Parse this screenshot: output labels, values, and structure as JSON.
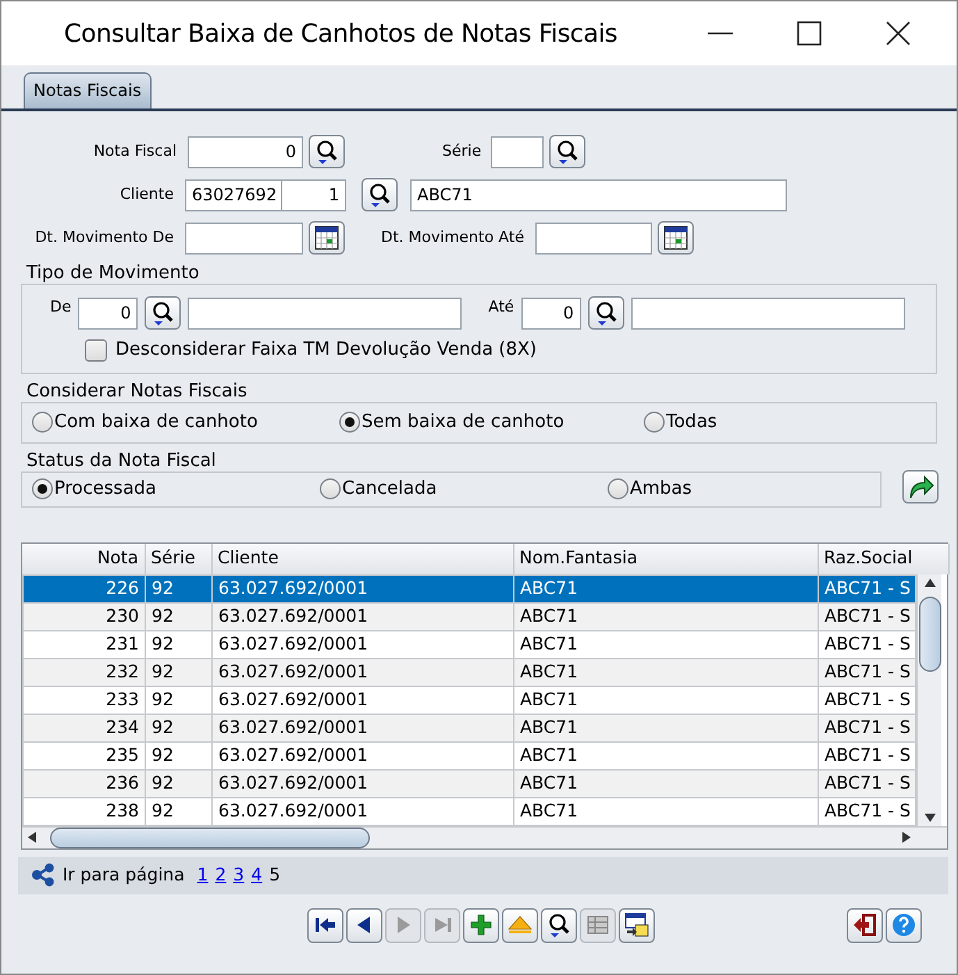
{
  "window": {
    "title": "Consultar Baixa de Canhotos de Notas Fiscais"
  },
  "tabs": [
    {
      "label": "Notas Fiscais",
      "selected": true
    }
  ],
  "form": {
    "nota_fiscal": {
      "label": "Nota Fiscal",
      "value": "0"
    },
    "serie": {
      "label": "Série"
    },
    "cliente": {
      "label": "Cliente",
      "code": "63027692",
      "branch": "1",
      "name": "ABC71"
    },
    "dt_de": {
      "label": "Dt. Movimento De"
    },
    "dt_ate": {
      "label": "Dt. Movimento Até"
    }
  },
  "tipo_movimento": {
    "title": "Tipo de Movimento",
    "de": {
      "label": "De",
      "value": "0"
    },
    "ate": {
      "label": "Até",
      "value": "0"
    },
    "option": {
      "label": "Desconsiderar Faixa TM Devolução Venda (8X)",
      "checked": false
    }
  },
  "considerar": {
    "title": "Considerar Notas Fiscais",
    "options": [
      {
        "label": "Com baixa de canhoto",
        "selected": false
      },
      {
        "label": "Sem baixa de canhoto",
        "selected": true
      },
      {
        "label": "Todas",
        "selected": false
      }
    ]
  },
  "status": {
    "title": "Status da Nota Fiscal",
    "options": [
      {
        "label": "Processada",
        "selected": true
      },
      {
        "label": "Cancelada",
        "selected": false
      },
      {
        "label": "Ambas",
        "selected": false
      }
    ]
  },
  "table": {
    "columns": [
      "Nota",
      "Série",
      "Cliente",
      "Nom.Fantasia",
      "Raz.Social"
    ],
    "rows": [
      {
        "cells": [
          "226",
          "92",
          "63.027.692/0001",
          "ABC71",
          "ABC71 - S"
        ],
        "selected": true
      },
      {
        "cells": [
          "230",
          "92",
          "63.027.692/0001",
          "ABC71",
          "ABC71 - S"
        ],
        "selected": false
      },
      {
        "cells": [
          "231",
          "92",
          "63.027.692/0001",
          "ABC71",
          "ABC71 - S"
        ],
        "selected": false
      },
      {
        "cells": [
          "232",
          "92",
          "63.027.692/0001",
          "ABC71",
          "ABC71 - S"
        ],
        "selected": false
      },
      {
        "cells": [
          "233",
          "92",
          "63.027.692/0001",
          "ABC71",
          "ABC71 - S"
        ],
        "selected": false
      },
      {
        "cells": [
          "234",
          "92",
          "63.027.692/0001",
          "ABC71",
          "ABC71 - S"
        ],
        "selected": false
      },
      {
        "cells": [
          "235",
          "92",
          "63.027.692/0001",
          "ABC71",
          "ABC71 - S"
        ],
        "selected": false
      },
      {
        "cells": [
          "236",
          "92",
          "63.027.692/0001",
          "ABC71",
          "ABC71 - S"
        ],
        "selected": false
      },
      {
        "cells": [
          "238",
          "92",
          "63.027.692/0001",
          "ABC71",
          "ABC71 - S"
        ],
        "selected": false
      }
    ]
  },
  "pagination": {
    "label": "Ir para página",
    "pages": [
      {
        "label": "1",
        "selected": false
      },
      {
        "label": "2",
        "selected": false
      },
      {
        "label": "3",
        "selected": false
      },
      {
        "label": "4",
        "selected": false
      },
      {
        "label": "5",
        "selected": true
      }
    ]
  },
  "toolbar": [
    {
      "kind": "first",
      "disabled": false
    },
    {
      "kind": "prev",
      "disabled": false
    },
    {
      "kind": "next",
      "disabled": true
    },
    {
      "kind": "last",
      "disabled": true
    },
    {
      "kind": "add",
      "disabled": false
    },
    {
      "kind": "eject",
      "disabled": false
    },
    {
      "kind": "search",
      "disabled": false
    },
    {
      "kind": "grid",
      "disabled": true
    },
    {
      "kind": "export",
      "disabled": false
    }
  ],
  "actions": [
    {
      "kind": "exit"
    },
    {
      "kind": "help"
    }
  ]
}
